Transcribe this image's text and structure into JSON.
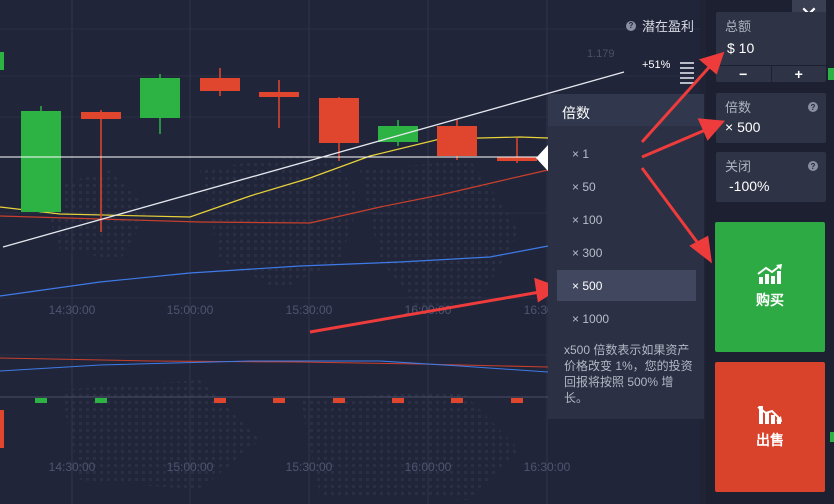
{
  "chart": {
    "potential_label": "潜在盈利",
    "price_level": "1.179",
    "profit_percent": "+51%",
    "time_labels_main": [
      "14:30:00",
      "15:00:00",
      "15:30:00",
      "16:00:00",
      "16:30:00"
    ],
    "time_labels_bottom": [
      "14:30:00",
      "15:00:00",
      "15:30:00",
      "16:00:00",
      "16:30:00"
    ],
    "colors": {
      "up": "#2cb344",
      "down": "#e0462e",
      "ma_yellow": "#e8d23a",
      "ma_red": "#c8402c",
      "ma_blue": "#3e7be8",
      "trend": "#d8dbe4"
    }
  },
  "multiplier_dropdown": {
    "title": "倍数",
    "options": [
      "× 1",
      "× 50",
      "× 100",
      "× 300",
      "× 500",
      "× 1000"
    ],
    "selected": "× 500",
    "description": "x500 倍数表示如果资产价格改变 1%，您的投资回报将按照 500% 增长。"
  },
  "panel": {
    "amount": {
      "label": "总额",
      "value": "$ 10",
      "minus": "−",
      "plus": "+"
    },
    "multiplier": {
      "label": "倍数",
      "value": "× 500"
    },
    "close": {
      "label": "关闭",
      "value": "-100%"
    },
    "buy_label": "购买",
    "sell_label": "出售"
  }
}
